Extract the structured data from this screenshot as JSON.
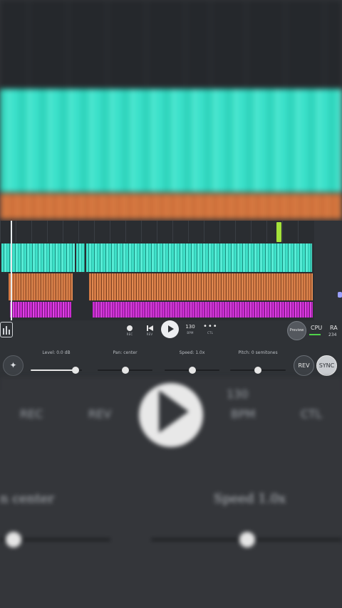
{
  "transport": {
    "rec_label": "REC",
    "rev_label": "REV",
    "bpm_value": "130",
    "bpm_label": "BPM",
    "ctl_dots": "•••",
    "ctl_label": "CTL",
    "preview_label": "Preview",
    "cpu_label": "CPU",
    "ram_label": "RA",
    "ram_value": "234"
  },
  "controls": {
    "level_label": "Level: 0.0 dB",
    "level_value": 0.88,
    "pan_label": "Pan: center",
    "pan_value": 0.5,
    "speed_label": "Speed: 1.0x",
    "speed_value": 0.5,
    "pitch_label": "Pitch: 0 semitones",
    "pitch_value": 0.5,
    "rev_button": "REV",
    "sync_button": "SYNC"
  },
  "colors": {
    "accent_track": "#3fe0c8",
    "track_orange": "#d47a45",
    "track_magenta": "#c92bd0",
    "marker": "#a4e23a",
    "cpu_meter": "#4fd24a"
  },
  "background_zoom": {
    "labels": [
      "REC",
      "REV",
      "130",
      "BPM",
      "CTL"
    ],
    "pan_label": "n center",
    "speed_label": "Speed 1.0x"
  }
}
